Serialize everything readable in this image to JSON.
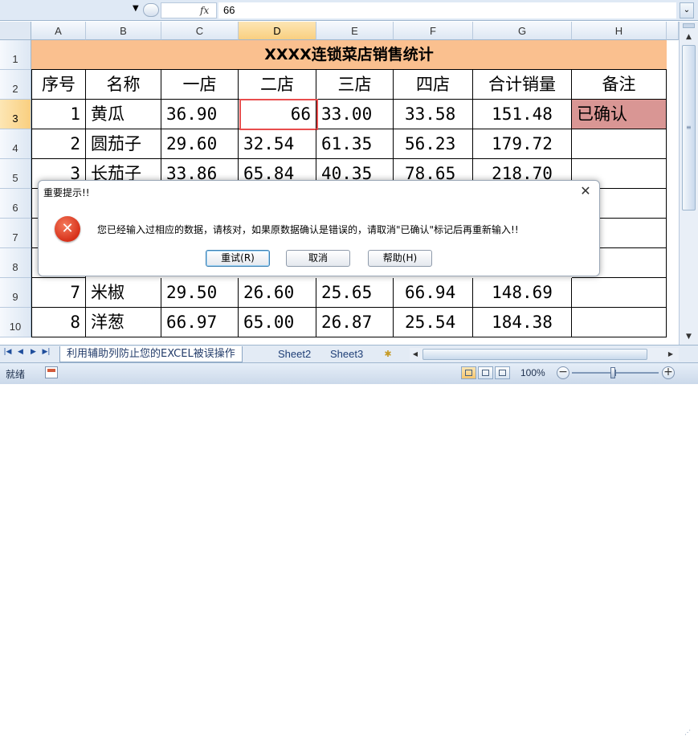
{
  "formula_bar": {
    "fx_label": "fx",
    "value": "66",
    "expand_icon": "double-chevron-down-icon"
  },
  "columns": [
    "A",
    "B",
    "C",
    "D",
    "E",
    "F",
    "G",
    "H"
  ],
  "active_column": "D",
  "rows": [
    "1",
    "2",
    "3",
    "4",
    "5",
    "6",
    "7",
    "8",
    "9",
    "10"
  ],
  "active_row": "3",
  "sheet": {
    "title": "XXXX连锁菜店销售统计",
    "headers": [
      "序号",
      "名称",
      "一店",
      "二店",
      "三店",
      "四店",
      "合计销量",
      "备注"
    ],
    "data_rows": [
      {
        "no": "1",
        "name": "黄瓜",
        "s1": "36.90",
        "s2": "66",
        "s3": "33.00",
        "s4": "33.58",
        "total": "151.48",
        "note": "已确认"
      },
      {
        "no": "2",
        "name": "圆茄子",
        "s1": "29.60",
        "s2": "32.54",
        "s3": "61.35",
        "s4": "56.23",
        "total": "179.72",
        "note": ""
      },
      {
        "no": "3",
        "name": "长茄子",
        "s1": "33.86",
        "s2": "65.84",
        "s3": "40.35",
        "s4": "78.65",
        "total": "218.70",
        "note": ""
      },
      {
        "no": "7",
        "name": "米椒",
        "s1": "29.50",
        "s2": "26.60",
        "s3": "25.65",
        "s4": "66.94",
        "total": "148.69",
        "note": ""
      },
      {
        "no": "8",
        "name": "洋葱",
        "s1": "66.97",
        "s2": "65.00",
        "s3": "26.87",
        "s4": "25.54",
        "total": "184.38",
        "note": ""
      }
    ],
    "note_highlight_color": "#d99694",
    "title_fill_color": "#fac08f",
    "selected_outline_color": "#e84d4d"
  },
  "sheet_tabs": {
    "tabs": [
      "利用辅助列防止您的EXCEL被误操作",
      "Sheet2",
      "Sheet3"
    ],
    "active_index": 0,
    "nav_icons": [
      "first-sheet-icon",
      "prev-sheet-icon",
      "next-sheet-icon",
      "last-sheet-icon"
    ],
    "new_sheet_icon": "insert-sheet-icon"
  },
  "status_bar": {
    "status": "就绪",
    "zoom": "100%",
    "zoom_level": 1.0
  },
  "dialog": {
    "title": "重要提示!!",
    "message": "您已经输入过相应的数据，请核对，如果原数据确认是错误的，请取消\"已确认\"标记后再重新输入!!",
    "icon": "error-icon",
    "buttons": [
      "重试(R)",
      "取消",
      "帮助(H)"
    ],
    "default_button_index": 0
  }
}
